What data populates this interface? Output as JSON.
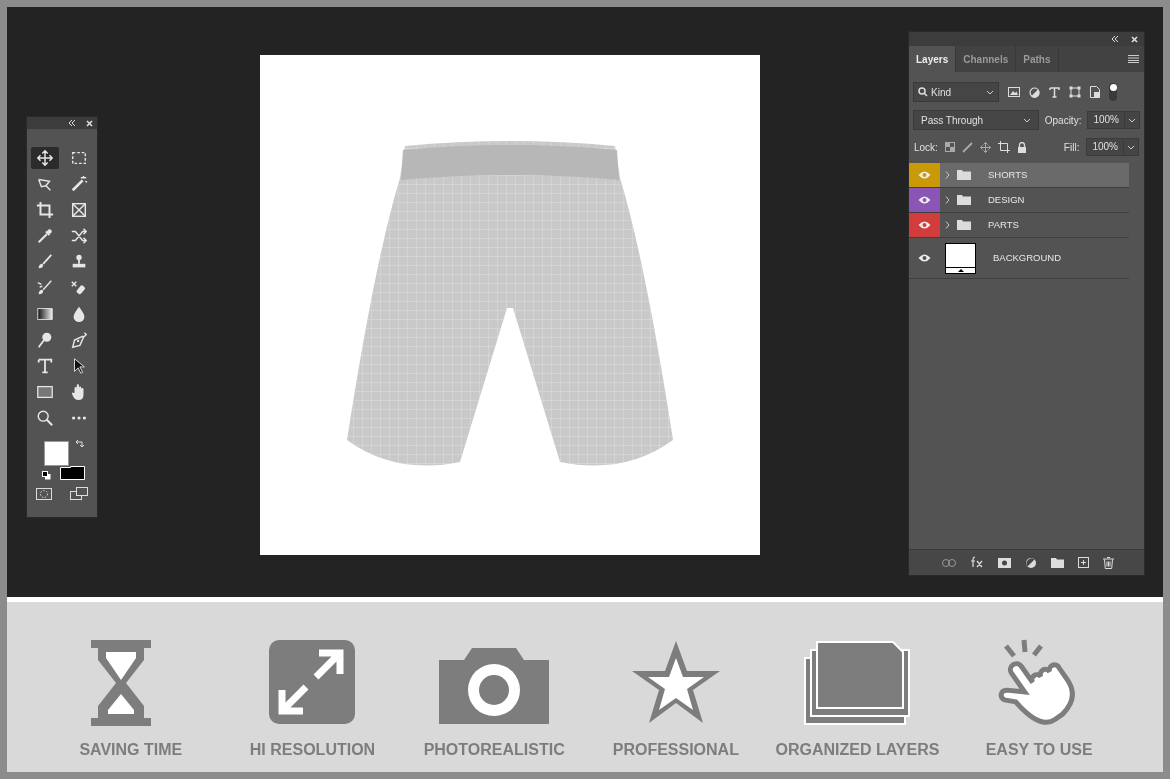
{
  "toolbox": {
    "tools": [
      {
        "kind": "move",
        "selected": true
      },
      {
        "kind": "marquee",
        "selected": false
      },
      {
        "kind": "lasso",
        "selected": false
      },
      {
        "kind": "wand",
        "selected": false
      },
      {
        "kind": "crop",
        "selected": false
      },
      {
        "kind": "frame",
        "selected": false
      },
      {
        "kind": "eyedropper",
        "selected": false
      },
      {
        "kind": "crossed-arrows",
        "selected": false
      },
      {
        "kind": "brush",
        "selected": false
      },
      {
        "kind": "stamp",
        "selected": false
      },
      {
        "kind": "history-brush",
        "selected": false
      },
      {
        "kind": "eraser",
        "selected": false
      },
      {
        "kind": "gradient",
        "selected": false
      },
      {
        "kind": "drop",
        "selected": false
      },
      {
        "kind": "dodge",
        "selected": false
      },
      {
        "kind": "pen",
        "selected": false
      },
      {
        "kind": "type",
        "selected": false
      },
      {
        "kind": "pointer",
        "selected": false
      },
      {
        "kind": "rectangle",
        "selected": false
      },
      {
        "kind": "hand",
        "selected": false
      },
      {
        "kind": "zoom",
        "selected": false
      },
      {
        "kind": "more",
        "selected": false
      }
    ]
  },
  "layers_panel": {
    "tabs": [
      {
        "label": "Layers",
        "selected": true
      },
      {
        "label": "Channels",
        "selected": false
      },
      {
        "label": "Paths",
        "selected": false
      }
    ],
    "filter": "Kind",
    "filter_on": true,
    "blend_mode": "Pass Through",
    "opacity_label": "Opacity:",
    "opacity": "100%",
    "lock_label": "Lock:",
    "fill_label": "Fill:",
    "fill": "100%",
    "layers": [
      {
        "name": "SHORTS",
        "kind": "group",
        "color": "#c99a06",
        "visible": true,
        "expanded": false,
        "selected": true
      },
      {
        "name": "DESIGN",
        "kind": "group",
        "color": "#8a55b4",
        "visible": true,
        "expanded": false,
        "selected": false
      },
      {
        "name": "PARTS",
        "kind": "group",
        "color": "#d23c3c",
        "visible": true,
        "expanded": false,
        "selected": false
      },
      {
        "name": "BACKGROUND",
        "kind": "image",
        "visible": true,
        "selected": false
      }
    ]
  },
  "features": [
    {
      "kind": "hourglass",
      "label": "SAVING TIME"
    },
    {
      "kind": "expand",
      "label": "HI RESOLUTION"
    },
    {
      "kind": "camera",
      "label": "PHOTOREALISTIC"
    },
    {
      "kind": "star",
      "label": "PROFESSIONAL"
    },
    {
      "kind": "layers",
      "label": "ORGANIZED LAYERS"
    },
    {
      "kind": "hand",
      "label": "EASY TO USE"
    }
  ]
}
